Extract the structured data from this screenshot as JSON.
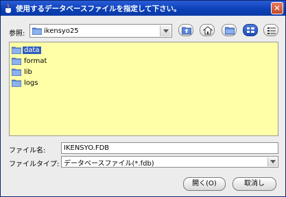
{
  "window": {
    "title": "使用するデータベースファイルを指定して下さい。",
    "close_glyph": "✕"
  },
  "lookin": {
    "label": "参照:",
    "value": "ikensyo25"
  },
  "toolbar": {
    "icons": [
      "up-folder-icon",
      "home-icon",
      "new-folder-icon",
      "list-view-icon",
      "details-view-icon"
    ],
    "active_view": "list-view"
  },
  "files": [
    {
      "name": "data",
      "selected": true
    },
    {
      "name": "format",
      "selected": false
    },
    {
      "name": "lib",
      "selected": false
    },
    {
      "name": "logs",
      "selected": false
    }
  ],
  "filename": {
    "label": "ファイル名:",
    "value": "IKENSYO.FDB"
  },
  "filetype": {
    "label": "ファイルタイプ:",
    "value": "データベースファイル(*.fdb)"
  },
  "buttons": {
    "open": "開く(O)",
    "cancel": "取消し"
  },
  "colors": {
    "titlebar": "#0a3fb5",
    "list_background": "#ffffa8",
    "selection": "#2f5dba",
    "close_button": "#c44a25"
  }
}
